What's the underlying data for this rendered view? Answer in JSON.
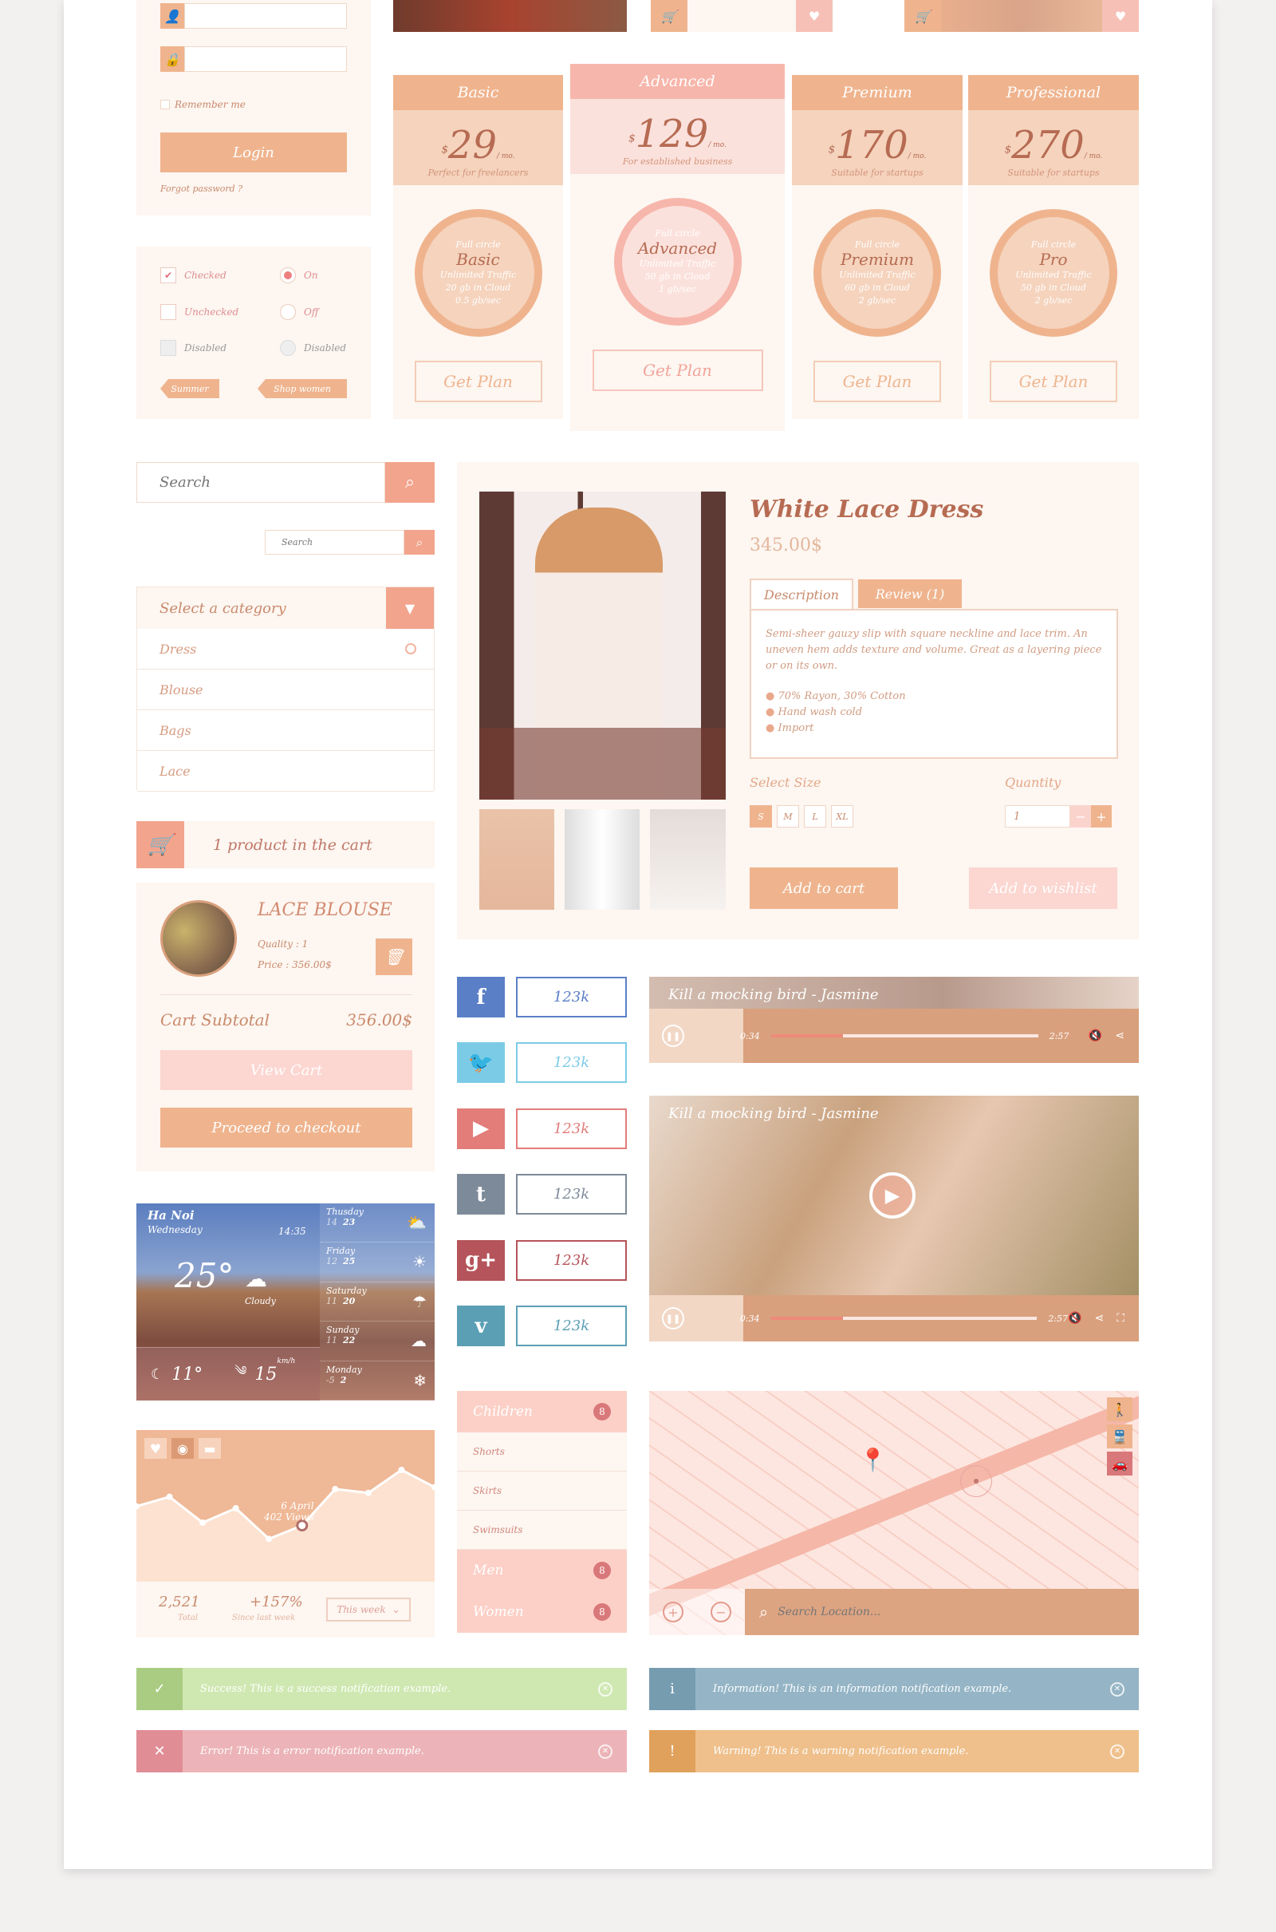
{
  "colors": {
    "accent": "#efb48e",
    "pink": "#f7b6ab",
    "text": "#c98a6c",
    "dark": "#b66b52"
  },
  "login": {
    "remember": "Remember me",
    "login_label": "Login",
    "forgot": "Forgot password ?"
  },
  "controls": {
    "checked": "Checked",
    "unchecked": "Unchecked",
    "disabled_cb": "Disabled",
    "on": "On",
    "off": "Off",
    "disabled_radio": "Disabled",
    "tags": [
      "Summer",
      "Shop women"
    ]
  },
  "pricing": [
    {
      "title": "Basic",
      "price": "29",
      "per": "/ mo.",
      "tagline": "Perfect for freelancers",
      "seal_top": "Full circle",
      "seal_name": "Basic",
      "features": [
        "Unlimited Traffic",
        "20 gb in Cloud",
        "0.5 gb/sec"
      ],
      "cta": "Get Plan"
    },
    {
      "title": "Advanced",
      "price": "129",
      "per": "/ mo.",
      "tagline": "For established business",
      "seal_top": "Full circle",
      "seal_name": "Advanced",
      "features": [
        "Unlimited Traffic",
        "50 gb in Cloud",
        "1 gb/sec"
      ],
      "cta": "Get Plan"
    },
    {
      "title": "Premium",
      "price": "170",
      "per": "/ mo.",
      "tagline": "Suitable for startups",
      "seal_top": "Full circle",
      "seal_name": "Premium",
      "features": [
        "Unlimited Traffic",
        "60 gb in Cloud",
        "2 gb/sec"
      ],
      "cta": "Get Plan"
    },
    {
      "title": "Professional",
      "price": "270",
      "per": "/ mo.",
      "tagline": "Suitable for startups",
      "seal_top": "Full circle",
      "seal_name": "Pro",
      "features": [
        "Unlimited Traffic",
        "50 gb in Cloud",
        "2 gb/sec"
      ],
      "cta": "Get Plan"
    }
  ],
  "search": {
    "placeholder": "Search",
    "small_placeholder": "Search"
  },
  "category": {
    "label": "Select a category",
    "options": [
      "Dress",
      "Blouse",
      "Bags",
      "Lace"
    ]
  },
  "cart": {
    "header": "1 product in the cart",
    "item_name": "LACE BLOUSE",
    "quantity": "Quality : 1",
    "price": "Price : 356.00$",
    "subtotal_label": "Cart Subtotal",
    "subtotal": "356.00$",
    "view": "View Cart",
    "checkout": "Proceed to checkout"
  },
  "weather": {
    "city": "Ha Noi",
    "day": "Wednesday",
    "time": "14:35",
    "temp": "25°",
    "cond": "Cloudy",
    "night": "11°",
    "wind": "15",
    "wind_unit": "km/h",
    "forecast": [
      {
        "day": "Thusday",
        "lo": "14",
        "hi": "23",
        "icon": "sun-cloud-icon"
      },
      {
        "day": "Friday",
        "lo": "12",
        "hi": "25",
        "icon": "sun-icon"
      },
      {
        "day": "Saturday",
        "lo": "11",
        "hi": "20",
        "icon": "rain-icon"
      },
      {
        "day": "Sunday",
        "lo": "11",
        "hi": "22",
        "icon": "cloud-icon"
      },
      {
        "day": "Monday",
        "lo": "-5",
        "hi": "2",
        "icon": "snow-icon"
      }
    ]
  },
  "stats": {
    "tooltip_date": "6 April",
    "tooltip_views": "402 Views",
    "total": "2,521",
    "total_label": "Total",
    "change": "+157%",
    "change_label": "Since last week",
    "period": "This week",
    "series": [
      62,
      72,
      45,
      60,
      28,
      42,
      80,
      76,
      100,
      82
    ]
  },
  "product": {
    "title": "White Lace Dress",
    "price": "345.00$",
    "tabs": [
      "Description",
      "Review (1)"
    ],
    "description": "Semi-sheer gauzy slip with square neckline and lace trim. An uneven hem adds texture and volume. Great as a layering piece or on its own.",
    "bullets": [
      "70% Rayon, 30% Cotton",
      "Hand wash cold",
      "Import"
    ],
    "size_label": "Select Size",
    "sizes": [
      "S",
      "M",
      "L",
      "XL"
    ],
    "qty_label": "Quantity",
    "qty": "1",
    "add_cart": "Add to cart",
    "add_wish": "Add to wishlist"
  },
  "social": [
    {
      "net": "facebook",
      "glyph": "f",
      "count": "123k",
      "color": "#5b7fc7"
    },
    {
      "net": "twitter",
      "glyph": "🐦",
      "count": "123k",
      "color": "#7ccbe6"
    },
    {
      "net": "youtube",
      "glyph": "▶",
      "count": "123k",
      "color": "#e27d7a"
    },
    {
      "net": "tumblr",
      "glyph": "t",
      "count": "123k",
      "color": "#7d8a99"
    },
    {
      "net": "google-plus",
      "glyph": "g+",
      "count": "123k",
      "color": "#b5545a"
    },
    {
      "net": "vimeo",
      "glyph": "v",
      "count": "123k",
      "color": "#5b9fb5"
    }
  ],
  "media": {
    "title": "Kill a mocking bird - Jasmine",
    "current": "0:34",
    "duration": "2:57",
    "progress": 0.27
  },
  "menu": [
    {
      "label": "Children",
      "count": "8",
      "type": "head"
    },
    {
      "label": "Shorts",
      "type": "sub"
    },
    {
      "label": "Skirts",
      "type": "sub"
    },
    {
      "label": "Swimsuits",
      "type": "sub"
    },
    {
      "label": "Men",
      "count": "8",
      "type": "head"
    },
    {
      "label": "Women",
      "count": "8",
      "type": "head"
    }
  ],
  "map": {
    "search_placeholder": "Search Location..."
  },
  "notifications": [
    {
      "type": "success",
      "icon": "✓",
      "text": "Success! This is a success notification example.",
      "color": "#cfe8b2",
      "lead": "#a9cc82"
    },
    {
      "type": "info",
      "icon": "i",
      "text": "Information! This is an information notification example.",
      "color": "#95b5c6",
      "lead": "#769cb0"
    },
    {
      "type": "error",
      "icon": "✕",
      "text": "Error! This is a error notification example.",
      "color": "#ecb4b8",
      "lead": "#e08d96"
    },
    {
      "type": "warning",
      "icon": "!",
      "text": "Warning! This is a warning notification example.",
      "color": "#efc08c",
      "lead": "#e0a15c"
    }
  ]
}
